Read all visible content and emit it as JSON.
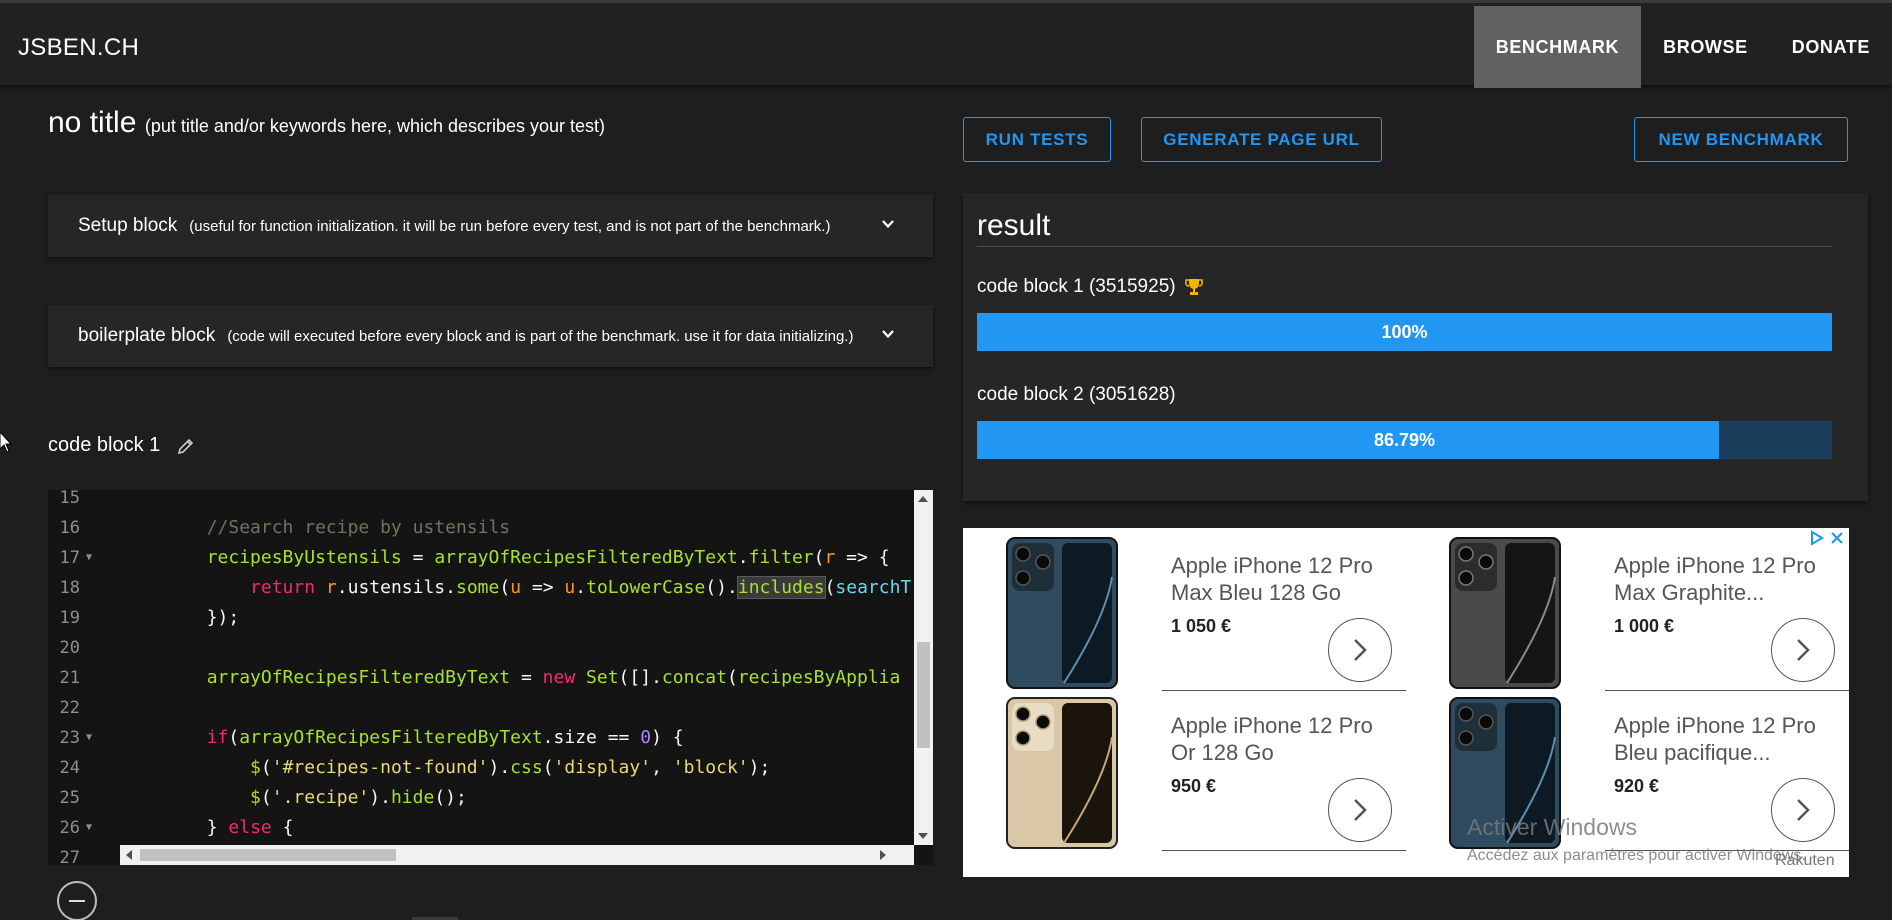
{
  "nav": {
    "brand": "JSBEN.CH",
    "items": [
      {
        "label": "BENCHMARK",
        "active": true
      },
      {
        "label": "BROWSE",
        "active": false
      },
      {
        "label": "DONATE",
        "active": false
      }
    ]
  },
  "title": {
    "main": "no title",
    "hint": "(put title and/or keywords here, which describes your test)"
  },
  "setup_block": {
    "name": "Setup block",
    "desc": "(useful for function initialization. it will be run before every test, and is not part of the benchmark.)"
  },
  "boilerplate_block": {
    "name": "boilerplate block",
    "desc": "(code will executed before every block and is part of the benchmark. use it for data initializing.)"
  },
  "code_block": {
    "label": "code block 1",
    "line_numbers": [
      "15",
      "16",
      "17",
      "18",
      "19",
      "20",
      "21",
      "22",
      "23",
      "24",
      "25",
      "26",
      "27"
    ],
    "foldable_lines": [
      "17",
      "23",
      "26"
    ],
    "lines": [
      "",
      "        //Search recipe by ustensils",
      "        recipesByUstensils = arrayOfRecipesFilteredByText.filter(r => {",
      "            return r.ustensils.some(u => u.toLowerCase().includes(searchT",
      "        });",
      "",
      "        arrayOfRecipesFilteredByText = new Set([].concat(recipesByApplia",
      "",
      "        if(arrayOfRecipesFilteredByText.size == 0) {",
      "            $('#recipes-not-found').css('display', 'block');",
      "            $('.recipe').hide();",
      "        } else {",
      ""
    ]
  },
  "actions": {
    "run_tests": "RUN TESTS",
    "generate_url": "GENERATE PAGE URL",
    "new_benchmark": "NEW BENCHMARK"
  },
  "result": {
    "title": "result",
    "items": [
      {
        "label": "code block 1 (3515925)",
        "percent": 100,
        "percent_label": "100%",
        "winner": true
      },
      {
        "label": "code block 2 (3051628)",
        "percent": 86.79,
        "percent_label": "86.79%",
        "winner": false
      }
    ]
  },
  "ad": {
    "products": [
      {
        "name": "Apple iPhone 12 Pro Max Bleu 128 Go",
        "price": "1 050 €",
        "color": "#2f4b5f"
      },
      {
        "name": "Apple iPhone 12 Pro Max Graphite...",
        "price": "1 000 €",
        "color": "#4a4a4a"
      },
      {
        "name": "Apple iPhone 12 Pro Or 128 Go",
        "price": "950 €",
        "color": "#d9c7a6"
      },
      {
        "name": "Apple iPhone 12 Pro Bleu pacifique...",
        "price": "920 €",
        "color": "#2f4b5f"
      }
    ],
    "sponsor": "Rakuten"
  },
  "watermark": {
    "title": "Activer Windows",
    "subtitle": "Accédez aux paramètres pour activer Windows."
  },
  "colors": {
    "accent": "#2196f3",
    "background": "#1e1e1e",
    "panel": "#262626"
  }
}
